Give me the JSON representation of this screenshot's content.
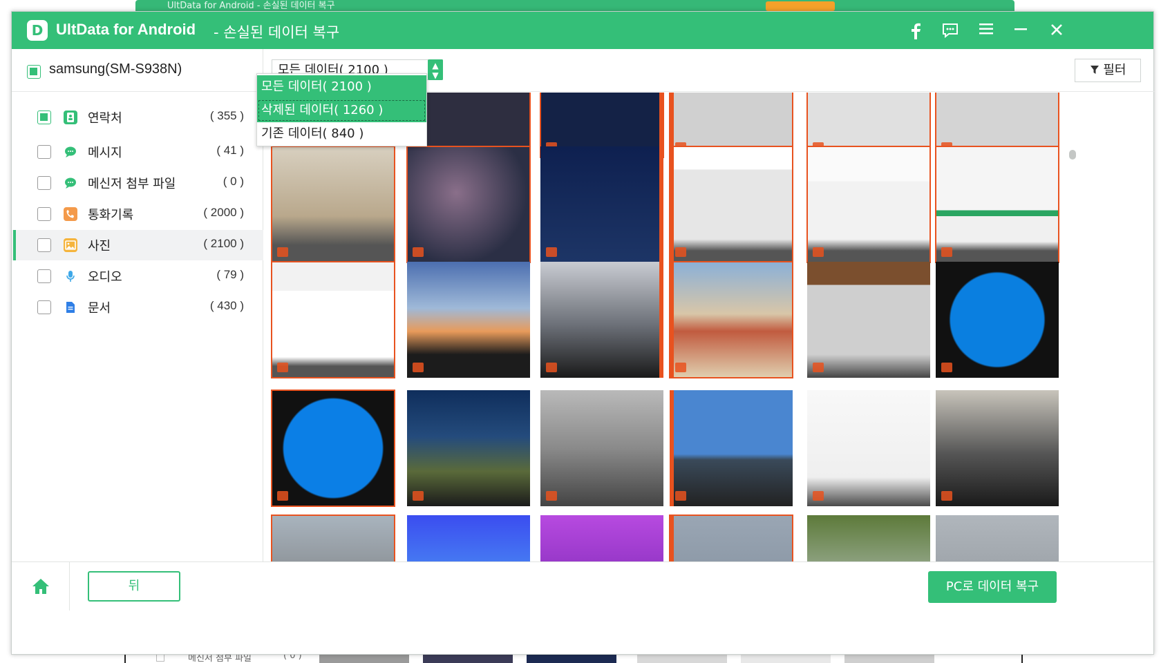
{
  "window": {
    "app_title": "UltData for Android",
    "subtitle": "- 손실된 데이터 복구",
    "logo_letter": "D"
  },
  "titlebar_icons": [
    "facebook-icon",
    "feedback-icon",
    "menu-icon",
    "minimize-icon",
    "close-icon"
  ],
  "background_window": {
    "title": "UltData for Android - 손실된 데이터 복구",
    "visible_item": "메신저 첨부 파일",
    "visible_count": "( 0 )"
  },
  "device": {
    "name": "samsung(SM-S938N)",
    "checked": true
  },
  "categories": [
    {
      "label": "연락처",
      "count": "( 355 )",
      "icon": "contacts-icon",
      "color": "#34bf78",
      "checked": true,
      "active": false
    },
    {
      "label": "메시지",
      "count": "( 41 )",
      "icon": "message-icon",
      "color": "#34bf78",
      "checked": false,
      "active": false
    },
    {
      "label": "메신저 첨부 파일",
      "count": "( 0 )",
      "icon": "messenger-icon",
      "color": "#34bf78",
      "checked": false,
      "active": false
    },
    {
      "label": "통화기록",
      "count": "( 2000 )",
      "icon": "call-log-icon",
      "color": "#f49a4a",
      "checked": false,
      "active": false
    },
    {
      "label": "사진",
      "count": "( 2100 )",
      "icon": "photo-icon",
      "color": "#f5b43c",
      "checked": false,
      "active": true
    },
    {
      "label": "오디오",
      "count": "( 79 )",
      "icon": "audio-icon",
      "color": "#3ea8e8",
      "checked": false,
      "active": false
    },
    {
      "label": "문서",
      "count": "( 430 )",
      "icon": "document-icon",
      "color": "#2f7fe6",
      "checked": false,
      "active": false
    }
  ],
  "toolbar": {
    "select_value": "모든 데이터( 2100 )",
    "filter_label": "필터"
  },
  "dropdown": {
    "options": [
      "모든 데이터( 2100 )",
      "삭제된 데이터( 1260 )",
      "기존 데이터( 840 )"
    ],
    "selected_index": 0,
    "hover_index": 1
  },
  "colors": {
    "accent": "#34bf78",
    "deleted_marker": "#e8521f"
  },
  "bottom": {
    "back_label": "뒤",
    "recover_label": "PC로 데이터 복구"
  }
}
